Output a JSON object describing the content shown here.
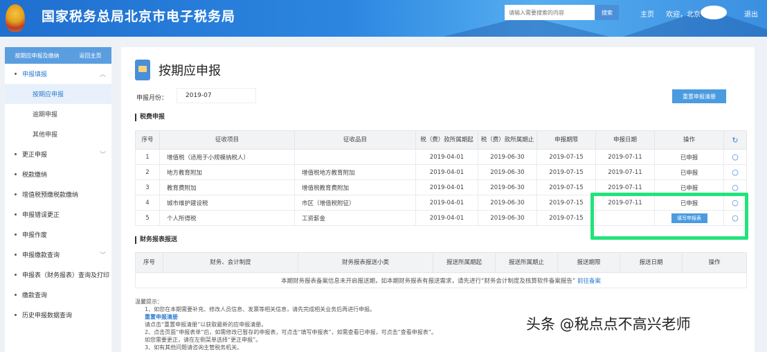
{
  "header": {
    "title": "国家税务总局北京市电子税务局",
    "search_placeholder": "请输入需要搜索的内容",
    "search_btn": "搜索",
    "home": "主页",
    "welcome": "欢迎，北京",
    "logout": "退出"
  },
  "sidebar": {
    "head_left": "按期应申报及缴纳",
    "head_right": "返回主页",
    "items": [
      {
        "label": "申报填报",
        "expanded": true
      },
      {
        "label": "更正申报",
        "chev": true
      },
      {
        "label": "税款缴纳"
      },
      {
        "label": "增值税预缴税款缴纳"
      },
      {
        "label": "申报错误更正"
      },
      {
        "label": "申报作废"
      },
      {
        "label": "申报缴款查询",
        "chev": true
      },
      {
        "label": "申报表（财务报表）查询及打印",
        "chev": true
      },
      {
        "label": "缴款查询"
      },
      {
        "label": "历史申报数据查询"
      }
    ],
    "sub": [
      "按期应申报",
      "逾期申报",
      "其他申报"
    ]
  },
  "main": {
    "title": "按期应申报",
    "period_label": "申报月份：",
    "period_value": "2019-07",
    "reset_btn": "重置申报清册",
    "sec1": "税费申报",
    "headers": [
      "序号",
      "征收项目",
      "征收品目",
      "税（费）款所属期起",
      "税（费）款所属期止",
      "申报期限",
      "申报日期",
      "操作"
    ],
    "rows": [
      [
        "1",
        "增值税（适用于小规模纳税人）",
        "",
        "2019-04-01",
        "2019-06-30",
        "2019-07-15",
        "2019-07-11",
        "已申报"
      ],
      [
        "2",
        "地方教育附加",
        "增值税地方教育附加",
        "2019-04-01",
        "2019-06-30",
        "2019-07-15",
        "2019-07-11",
        "已申报"
      ],
      [
        "3",
        "教育费附加",
        "增值税教育费附加",
        "2019-04-01",
        "2019-06-30",
        "2019-07-15",
        "2019-07-11",
        "已申报"
      ],
      [
        "4",
        "城市维护建设税",
        "市区（增值税附征）",
        "2019-04-01",
        "2019-06-30",
        "2019-07-15",
        "2019-07-11",
        "已申报"
      ],
      [
        "5",
        "个人所得税",
        "工资薪金",
        "2019-04-01",
        "2019-06-30",
        "2019-07-15",
        "",
        "填写申报表"
      ]
    ],
    "sec2": "财务报表报送",
    "headers2": [
      "序号",
      "财务、会计制度",
      "财务报表报送小类",
      "报送所属期起",
      "报送所属期止",
      "报送期限",
      "报送日期",
      "操作"
    ],
    "empty_msg": "本期财务报表备案信息未开启报送期，如本期财务报表有报送需求，请先进行“财务会计制度及核算软件备案报告”",
    "empty_link": "前往备案",
    "notes_title": "温馨提示：",
    "notes": [
      "1、如您在本期需要补充、修改人员信息、发票等相关信息，请先完成相关业务后再进行申报。",
      "请点击“重置申报清册”以获取最新的应申报清册。",
      "2、点击页面“申报表单”后，如需修改已暂存的申报表，可点击“填写申报表”，如需查看已申报，可点击“查看申报表”。",
      "如您需要更正，请在左侧菜单选择“更正申报”。",
      "3、如有其他问题请咨询主管税务机关。"
    ],
    "notes_link": "重置申报清册"
  },
  "watermark": "头条 @税点点不高兴老师"
}
